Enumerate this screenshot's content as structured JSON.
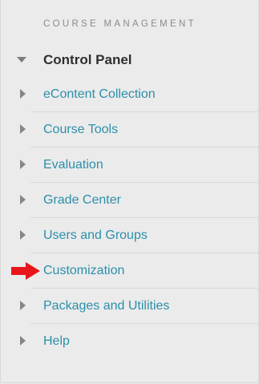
{
  "section_heading": "COURSE MANAGEMENT",
  "control_panel": {
    "label": "Control Panel",
    "expander_icon": "triangle-down-icon"
  },
  "menu_items": [
    {
      "label": "eContent Collection",
      "icon": "triangle-right-icon"
    },
    {
      "label": "Course Tools",
      "icon": "triangle-right-icon"
    },
    {
      "label": "Evaluation",
      "icon": "triangle-right-icon"
    },
    {
      "label": "Grade Center",
      "icon": "triangle-right-icon"
    },
    {
      "label": "Users and Groups",
      "icon": "triangle-right-icon"
    },
    {
      "label": "Customization",
      "icon": "red-arrow-icon"
    },
    {
      "label": "Packages and Utilities",
      "icon": "triangle-right-icon"
    },
    {
      "label": "Help",
      "icon": "triangle-right-icon"
    }
  ],
  "colors": {
    "background": "#ebebeb",
    "link": "#2c8fab",
    "heading": "#8a8a8a",
    "control_panel_text": "#2f2f2f",
    "triangle": "#868686",
    "highlight_arrow": "#e8151b"
  }
}
